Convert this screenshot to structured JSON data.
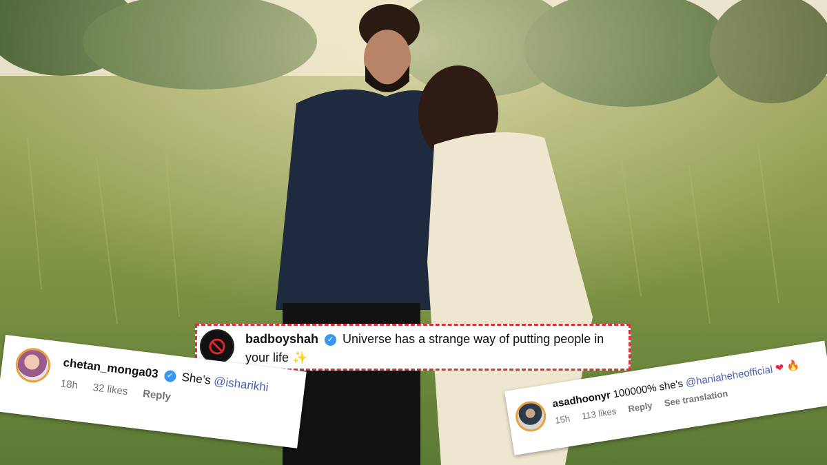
{
  "caption": {
    "username": "badboyshah",
    "text": "Universe has a strange way of putting people in your life",
    "emoji": "✨"
  },
  "comment_left": {
    "username": "chetan_monga03",
    "text": "She’s",
    "mention": "@isharikhi",
    "time": "18h",
    "likes": "32 likes",
    "reply": "Reply"
  },
  "comment_right": {
    "username": "asadhoonyr",
    "text": "100000% she’s",
    "mention": "@haniaheheofficial",
    "emoji_heart": "❤",
    "emoji_fire": "🔥",
    "time": "15h",
    "likes": "113 likes",
    "reply": "Reply",
    "translate": "See translation"
  },
  "icons": {
    "verified": "verified-badge-icon",
    "blocked": "no-entry-icon"
  },
  "colors": {
    "highlight_border": "#d9323a",
    "verified": "#3897f0",
    "mention": "#4a5fb5",
    "ring": "#e9a23b"
  }
}
